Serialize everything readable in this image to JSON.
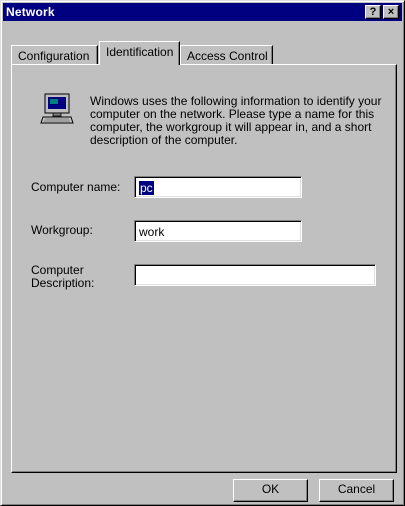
{
  "window": {
    "title": "Network",
    "help_label": "?",
    "close_label": "×"
  },
  "tabs": [
    {
      "label": "Configuration"
    },
    {
      "label": "Identification"
    },
    {
      "label": "Access Control"
    }
  ],
  "panel": {
    "info_text": "Windows uses the following information to identify your computer on the network.  Please type a name for this computer, the workgroup it will appear in, and a short description of the computer.",
    "icon": "network-computer-icon",
    "fields": {
      "computer_name_label": "Computer name:",
      "computer_name_value": "pc",
      "workgroup_label": "Workgroup:",
      "workgroup_value": "work",
      "description_label": "Computer Description:",
      "description_value": ""
    }
  },
  "buttons": {
    "ok": "OK",
    "cancel": "Cancel"
  },
  "colors": {
    "titlebar": "#000080",
    "face": "#c0c0c0",
    "selection": "#000080"
  }
}
